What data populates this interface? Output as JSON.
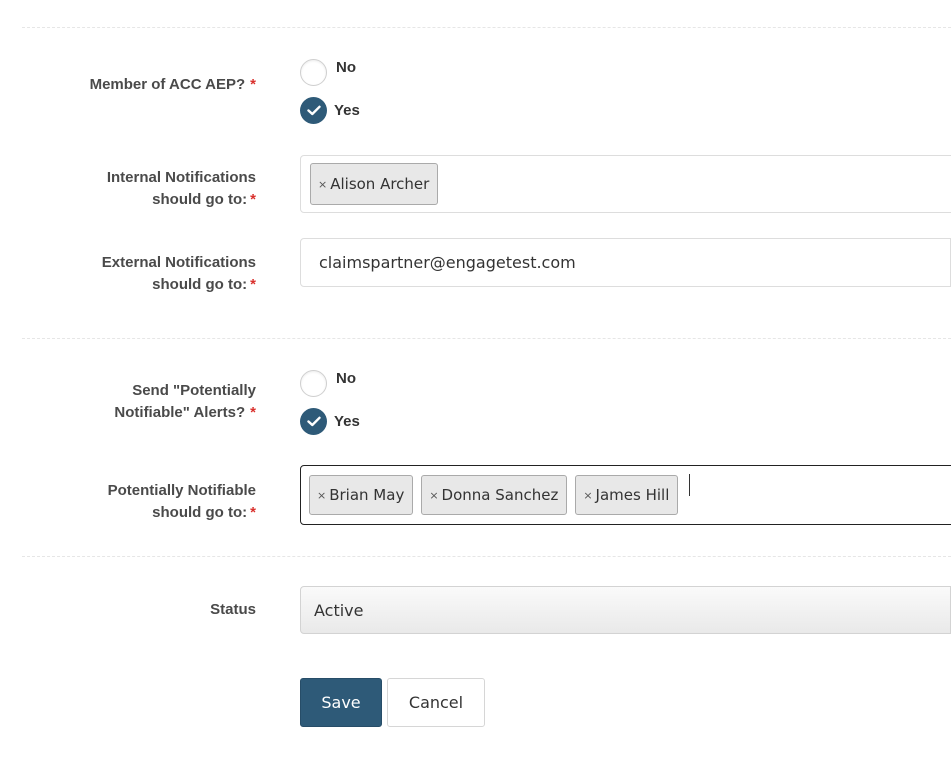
{
  "form": {
    "member_acc_aep": {
      "label": "Member of ACC AEP?",
      "required_mark": "*",
      "options": [
        {
          "label": "No",
          "checked": false
        },
        {
          "label": "Yes",
          "checked": true
        }
      ]
    },
    "internal_notifications": {
      "label_line1": "Internal Notifications",
      "label_line2": "should go to:",
      "required_mark": "*",
      "tags": [
        "Alison Archer"
      ],
      "tag_remove_glyph": "×"
    },
    "external_notifications": {
      "label_line1": "External Notifications",
      "label_line2": "should go to:",
      "required_mark": "*",
      "value": "claimspartner@engagetest.com"
    },
    "potentially_notifiable_alerts": {
      "label_line1": "Send \"Potentially",
      "label_line2": "Notifiable\" Alerts?",
      "required_mark": "*",
      "options": [
        {
          "label": "No",
          "checked": false
        },
        {
          "label": "Yes",
          "checked": true
        }
      ]
    },
    "potentially_notifiable_recipients": {
      "label_line1": "Potentially Notifiable",
      "label_line2": "should go to:",
      "required_mark": "*",
      "tags": [
        "Brian May",
        "Donna Sanchez",
        "James Hill"
      ],
      "tag_remove_glyph": "×"
    },
    "status": {
      "label": "Status",
      "value": "Active"
    }
  },
  "actions": {
    "save_label": "Save",
    "cancel_label": "Cancel"
  },
  "colors": {
    "accent": "#2e5a78",
    "required": "#d9302c",
    "tag_background": "#e8e8e8"
  },
  "icons": {
    "radio_checked": "checkmark-icon"
  }
}
